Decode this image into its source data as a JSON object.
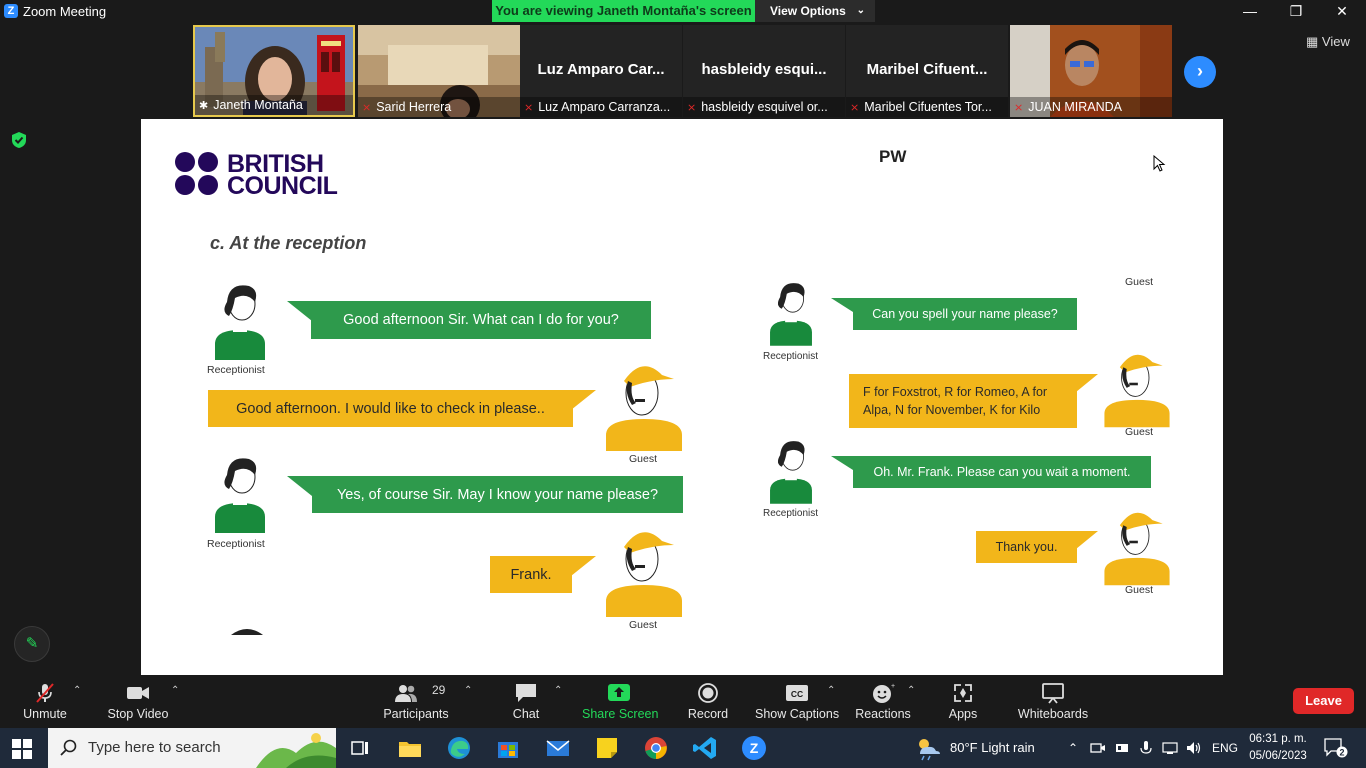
{
  "window": {
    "title": "Zoom Meeting",
    "banner": "You are viewing Janeth Montaña's screen",
    "view_options": "View Options",
    "view_button": "View"
  },
  "participants_strip": [
    {
      "label": "Janeth Montaña",
      "big_name": ""
    },
    {
      "label": "Sarid Herrera",
      "big_name": ""
    },
    {
      "label": "Luz Amparo Carranza...",
      "big_name": "Luz Amparo Car..."
    },
    {
      "label": "hasbleidy esquivel or...",
      "big_name": "hasbleidy esqui..."
    },
    {
      "label": "Maribel Cifuentes Tor...",
      "big_name": "Maribel Cifuent..."
    },
    {
      "label": "JUAN MIRANDA",
      "big_name": ""
    }
  ],
  "slide": {
    "logo_line1": "BRITISH",
    "logo_line2": "COUNCIL",
    "title": "PW",
    "section": "c. At the reception",
    "left_dialog": [
      {
        "speaker": "Receptionist",
        "text": "Good afternoon Sir. What can I do for you?"
      },
      {
        "speaker": "Guest",
        "text": "Good afternoon. I would like to check in please.."
      },
      {
        "speaker": "Receptionist",
        "text": "Yes, of course Sir. May I know your name please?"
      },
      {
        "speaker": "Guest",
        "text": "Frank."
      }
    ],
    "right_dialog": [
      {
        "speaker": "Receptionist",
        "text": "Can you spell your name please?"
      },
      {
        "speaker": "Guest",
        "text": "F for Foxstrot, R for Romeo, A for Alpa, N for November, K for Kilo"
      },
      {
        "speaker": "Receptionist",
        "text": "Oh. Mr. Frank. Please can you wait a moment."
      },
      {
        "speaker": "Guest",
        "text": "Thank you."
      }
    ],
    "top_guest_label": "Guest"
  },
  "toolbar": {
    "unmute": "Unmute",
    "stop_video": "Stop Video",
    "participants": "Participants",
    "participants_count": "29",
    "chat": "Chat",
    "share_screen": "Share Screen",
    "record": "Record",
    "show_captions": "Show Captions",
    "reactions": "Reactions",
    "apps": "Apps",
    "whiteboards": "Whiteboards",
    "leave": "Leave"
  },
  "taskbar": {
    "search_placeholder": "Type here to search",
    "weather": "80°F  Light rain",
    "language": "ENG",
    "time": "06:31 p. m.",
    "date": "05/06/2023",
    "notifications": "2"
  },
  "colors": {
    "banner_green": "#23d959",
    "bubble_green": "#2e9a4c",
    "bubble_yellow": "#f2b61a",
    "leave_red": "#e02828",
    "zoom_blue": "#2d8cff",
    "british_council_purple": "#23085a"
  }
}
